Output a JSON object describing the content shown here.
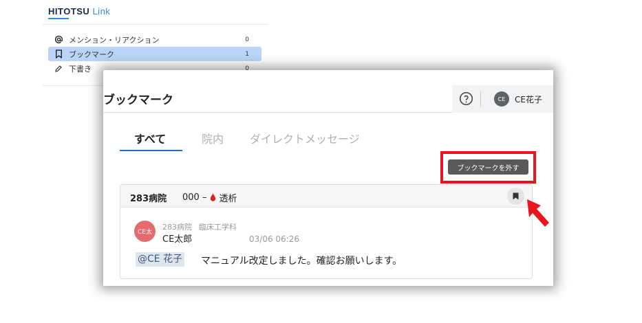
{
  "app": {
    "logo_main": "HITOTSU",
    "logo_sub": "Link"
  },
  "sidebar": {
    "items": [
      {
        "label": "メンション・リアクション",
        "count": "0",
        "icon": "at-icon"
      },
      {
        "label": "ブックマーク",
        "count": "1",
        "icon": "bookmark-outline-icon",
        "active": true
      },
      {
        "label": "下書き",
        "count": "0",
        "icon": "pencil-icon"
      }
    ]
  },
  "modal": {
    "title": "ブックマーク",
    "user": {
      "initials": "CE",
      "name": "CE花子"
    },
    "tabs": [
      {
        "label": "すべて",
        "active": true
      },
      {
        "label": "院内"
      },
      {
        "label": "ダイレクトメッセージ"
      }
    ],
    "remove_bookmark_button": "ブックマークを外す"
  },
  "card": {
    "hospital": "283病院",
    "room_prefix": "000 –",
    "room_name": "透析",
    "message": {
      "avatar_text": "CE太",
      "sender_hospital": "283病院",
      "sender_dept": "臨床工学科",
      "sender_name": "CE太郎",
      "time": "03/06 06:26",
      "mention": "@CE 花子",
      "text": "マニュアル改定しました。確認お願いします。"
    }
  },
  "colors": {
    "accent": "#1b6db8",
    "highlight": "#e8141e",
    "sidebar_active": "#b9d4f6",
    "sender_avatar": "#e66b6e",
    "drop": "#e02020"
  }
}
